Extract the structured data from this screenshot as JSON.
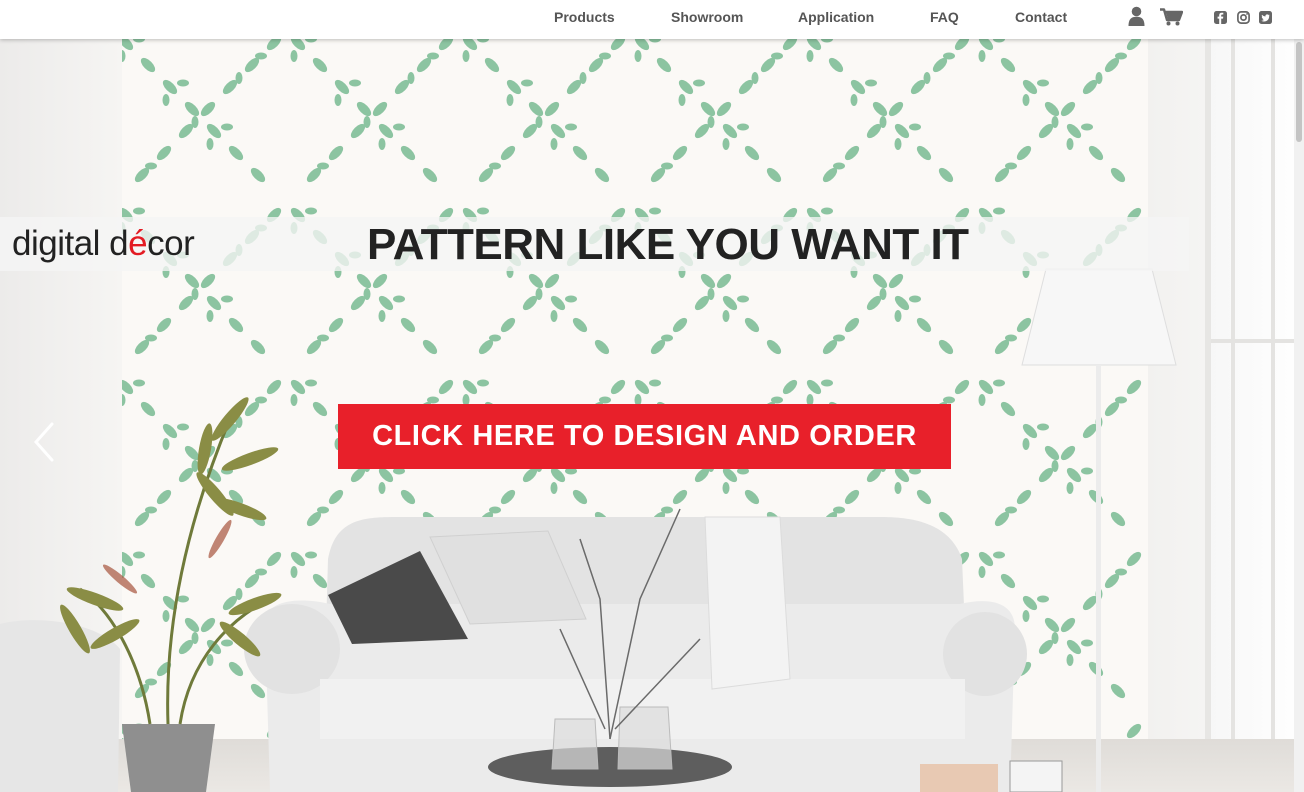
{
  "nav": {
    "items": [
      {
        "label": "Products"
      },
      {
        "label": "Showroom"
      },
      {
        "label": "Application"
      },
      {
        "label": "FAQ"
      },
      {
        "label": "Contact"
      }
    ],
    "icons": [
      "user-icon",
      "cart-icon",
      "facebook-icon",
      "instagram-icon",
      "twitter-icon"
    ]
  },
  "hero": {
    "logo_prefix": "digital d",
    "logo_accent": "é",
    "logo_suffix": "cor",
    "headline": "PATTERN LIKE YOU WANT IT",
    "cta": "CLICK HERE TO DESIGN AND ORDER"
  },
  "colors": {
    "accent": "#e8202a",
    "pattern": "#7dbd97",
    "nav_text": "#555555"
  }
}
